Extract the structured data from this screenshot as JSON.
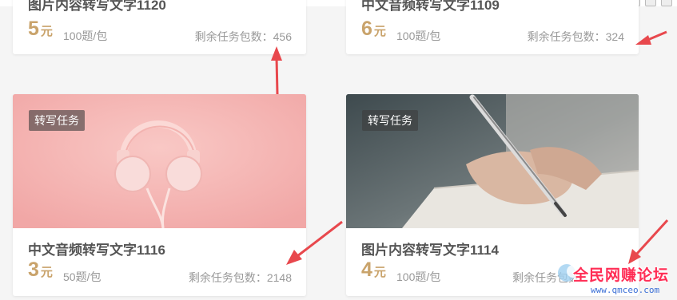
{
  "cards": [
    {
      "title": "图片内容转写文字1120",
      "price": "5",
      "unit": "元",
      "qty": "100题/包",
      "remaining": "剩余任务包数：456"
    },
    {
      "title": "中文音频转写文字1109",
      "price": "6",
      "unit": "元",
      "qty": "100题/包",
      "remaining": "剩余任务包数：324"
    },
    {
      "tag": "转写任务",
      "title": "中文音频转写文字1116",
      "price": "3",
      "unit": "元",
      "qty": "50题/包",
      "remaining": "剩余任务包数：2148",
      "image": "pink-headphones"
    },
    {
      "tag": "转写任务",
      "title": "图片内容转写文字1114",
      "price": "4",
      "unit": "元",
      "qty": "100题/包",
      "remaining": "剩余任务包数：",
      "image": "hand-writing-with-pen"
    }
  ],
  "annotation_color": "#e8484d",
  "price_color": "#c9a36b",
  "watermark": {
    "title": "全民网赚论坛",
    "url": "www.qmceo.com"
  }
}
